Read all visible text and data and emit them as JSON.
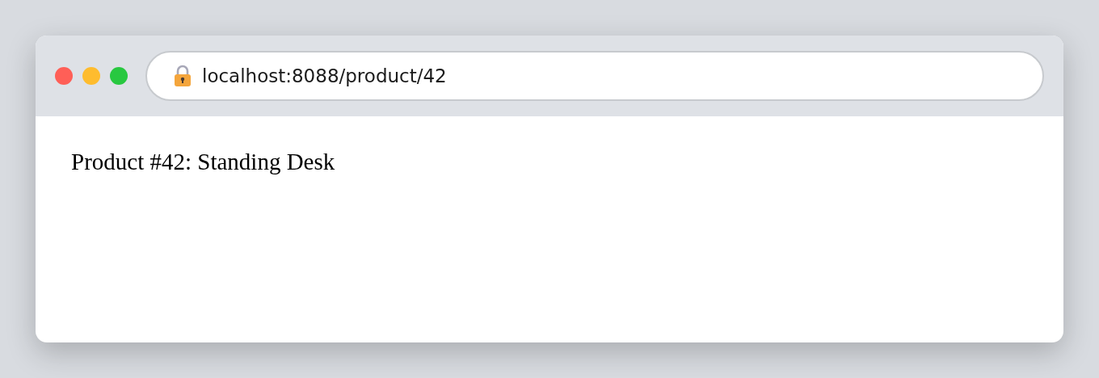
{
  "window": {
    "controls": [
      {
        "color": "#ff5f57"
      },
      {
        "color": "#febc2e"
      },
      {
        "color": "#28c840"
      }
    ],
    "address_bar": {
      "url": "localhost:8088/product/42"
    }
  },
  "page": {
    "heading": "Product #42: Standing Desk"
  }
}
